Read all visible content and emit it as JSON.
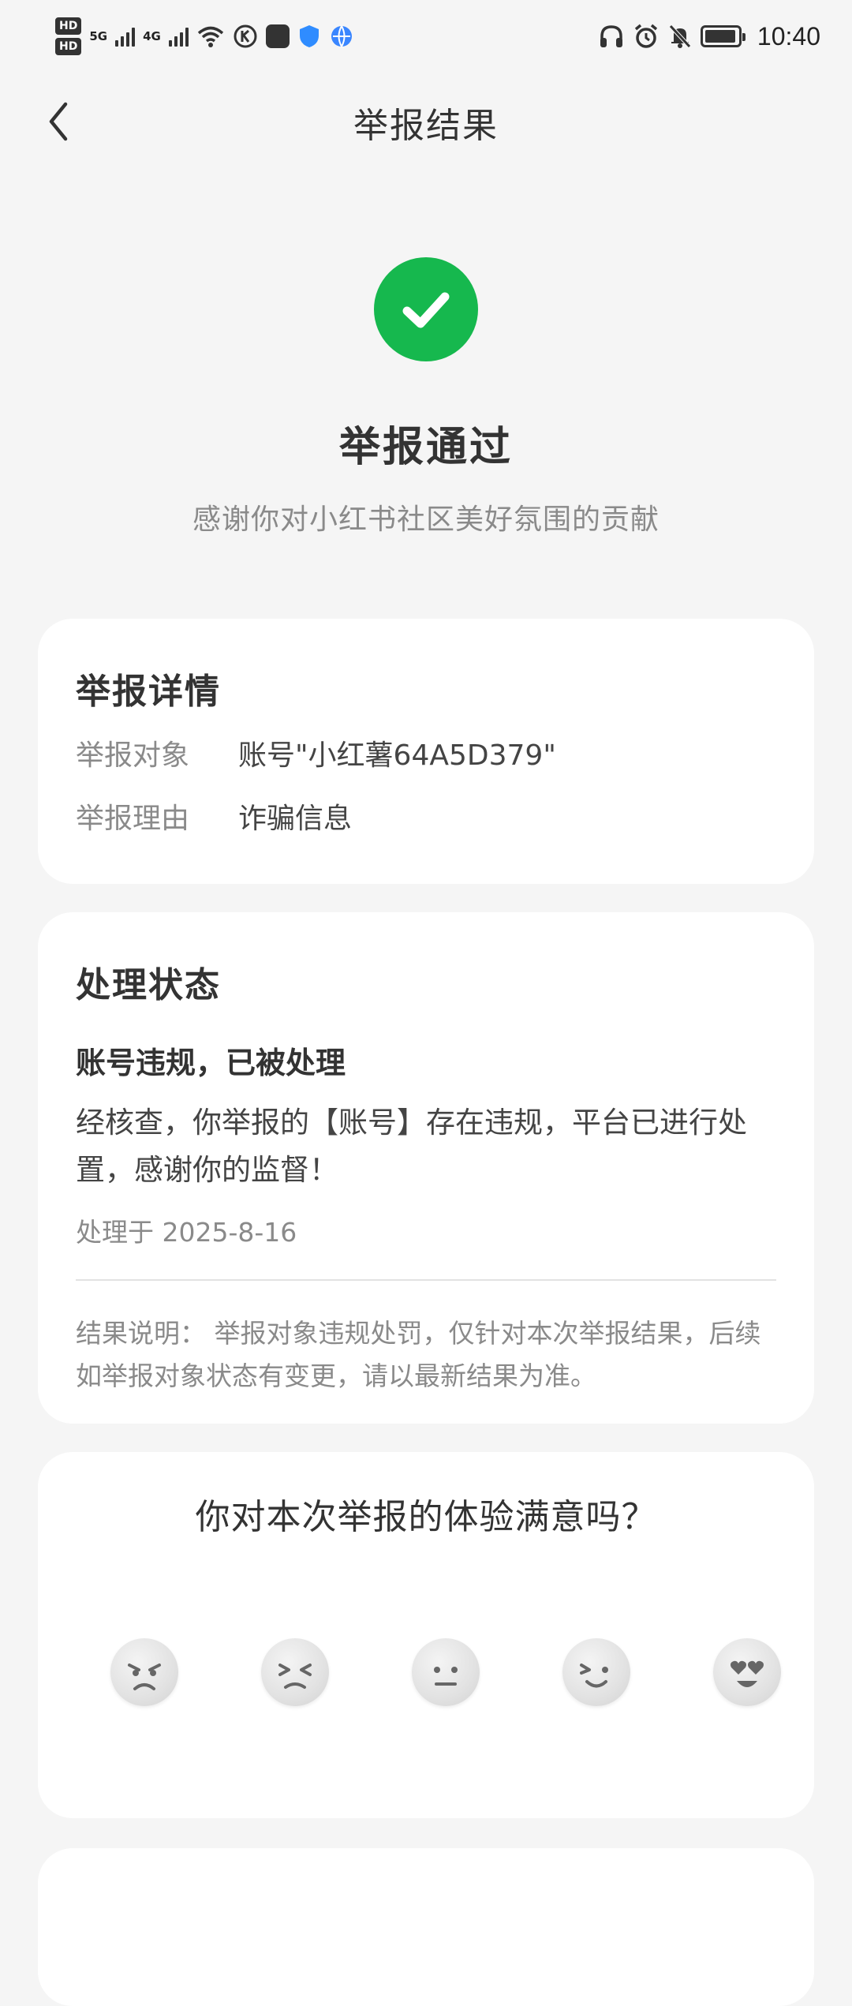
{
  "status_bar": {
    "hd1": "HD",
    "hd2": "HD",
    "net1": "5G",
    "net2": "4G",
    "time": "10:40",
    "icons": [
      "signal-icon",
      "wifi-icon",
      "headphones-icon",
      "alarm-icon",
      "bell-muted-icon",
      "battery-icon"
    ]
  },
  "header": {
    "title": "举报结果",
    "back_icon": "chevron-left-icon"
  },
  "hero": {
    "icon": "check-circle-icon",
    "accent": "#16b84e",
    "title": "举报通过",
    "subtitle": "感谢你对小红书社区美好氛围的贡献"
  },
  "details": {
    "title": "举报详情",
    "rows": [
      {
        "label": "举报对象",
        "value": "账号\"小红薯64A5D379\""
      },
      {
        "label": "举报理由",
        "value": "诈骗信息"
      }
    ]
  },
  "status": {
    "title": "处理状态",
    "headline": "账号违规，已被处理",
    "body": "经核查，你举报的【账号】存在违规，平台已进行处置，感谢你的监督！",
    "date": "处理于 2025-8-16",
    "note": "结果说明： 举报对象违规处罚，仅针对本次举报结果，后续如举报对象状态有变更，请以最新结果为准。"
  },
  "survey": {
    "question": "你对本次举报的体验满意吗？",
    "faces": [
      "angry-face-icon",
      "frustrated-face-icon",
      "neutral-face-icon",
      "smile-face-icon",
      "love-face-icon"
    ]
  }
}
